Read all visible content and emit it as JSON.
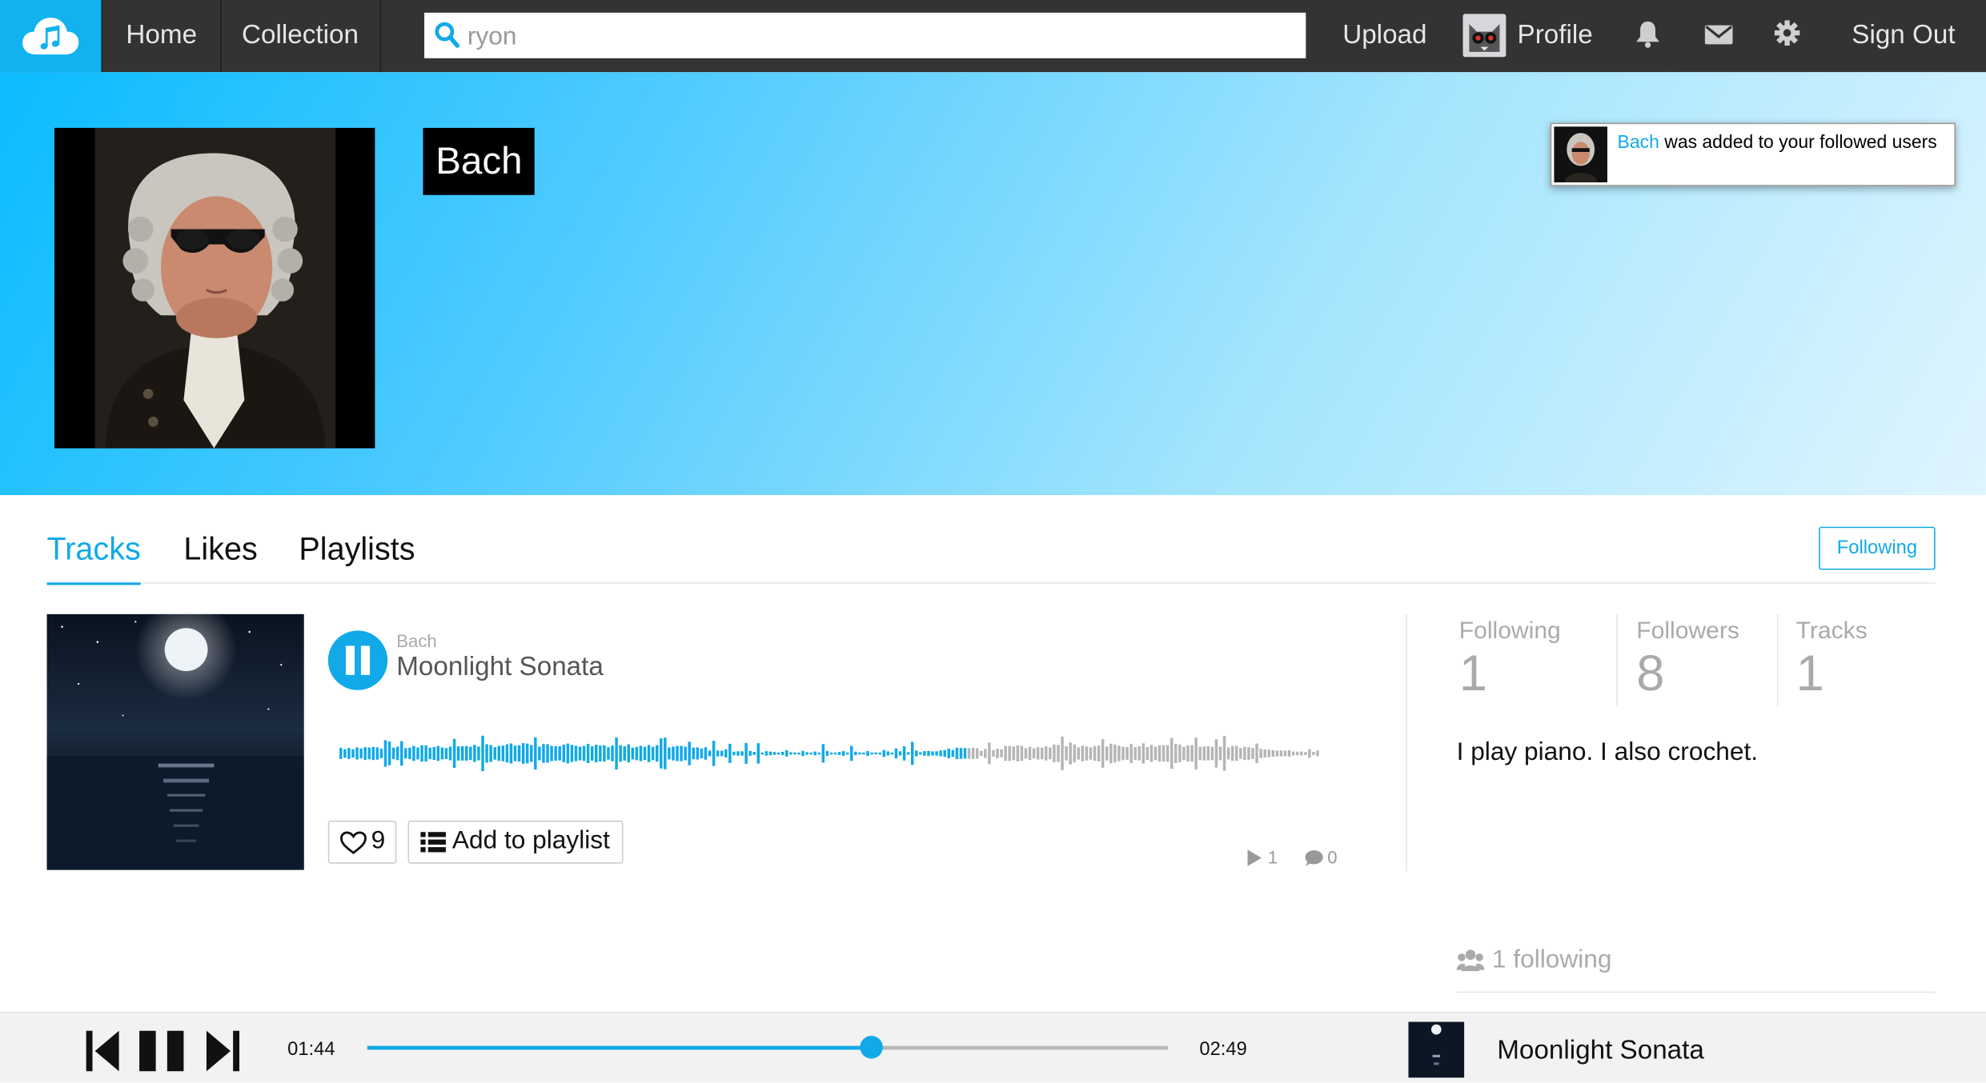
{
  "nav": {
    "home": "Home",
    "collection": "Collection",
    "search_value": "ryon",
    "upload": "Upload",
    "profile": "Profile",
    "sign_out": "Sign Out"
  },
  "colors": {
    "accent": "#11a9e8",
    "nav_bg": "#333333",
    "logo_bg": "#11b2ef"
  },
  "icons": [
    "cloud-music-logo-icon",
    "search-icon",
    "bell-icon",
    "envelope-icon",
    "gear-icon",
    "heart-icon",
    "list-icon",
    "play-count-icon",
    "comment-icon",
    "users-icon",
    "previous-icon",
    "pause-icon",
    "next-icon"
  ],
  "profile": {
    "name": "Bach",
    "bio": "I play piano. I also crochet.",
    "following_label": "Following",
    "following_count": "1",
    "followers_label": "Followers",
    "followers_count": "8",
    "tracks_label": "Tracks",
    "tracks_count": "1",
    "following_summary": "1 following"
  },
  "notification": {
    "user": "Bach",
    "message": " was added to your followed users"
  },
  "tabs": [
    "Tracks",
    "Likes",
    "Playlists"
  ],
  "follow_button": "Following",
  "track": {
    "artist": "Bach",
    "title": "Moonlight Sonata",
    "likes": "9",
    "add_to_playlist": "Add to playlist",
    "plays": "1",
    "comments": "0",
    "waveform_progress": 0.64
  },
  "player": {
    "current_time": "01:44",
    "duration": "02:49",
    "progress": 0.63,
    "title": "Moonlight Sonata"
  }
}
